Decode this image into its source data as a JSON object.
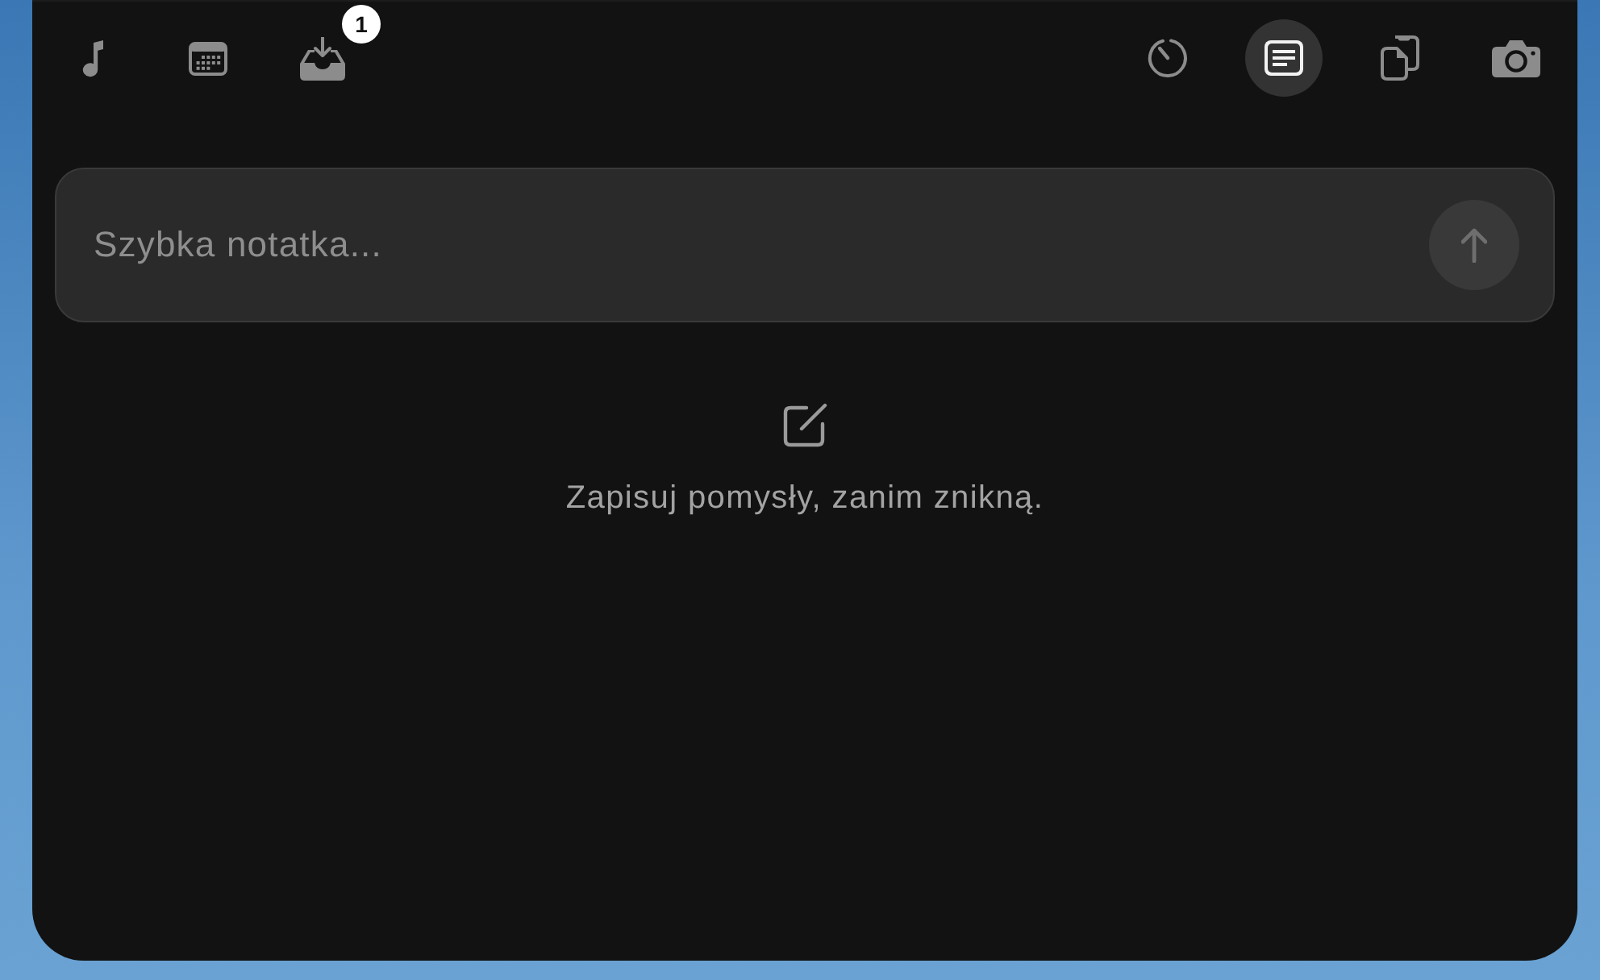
{
  "toolbar": {
    "left": [
      {
        "selected": false
      },
      {
        "selected": false
      },
      {
        "selected": false,
        "badge": "1"
      }
    ],
    "right": [
      {
        "selected": false
      },
      {
        "selected": true
      },
      {
        "selected": false
      },
      {
        "selected": false
      }
    ]
  },
  "note_input": {
    "placeholder": "Szybka notatka..."
  },
  "send_button": {
    "disabled": true
  },
  "empty_state": {
    "message": "Zapisuj pomysły, zanim znikną."
  }
}
